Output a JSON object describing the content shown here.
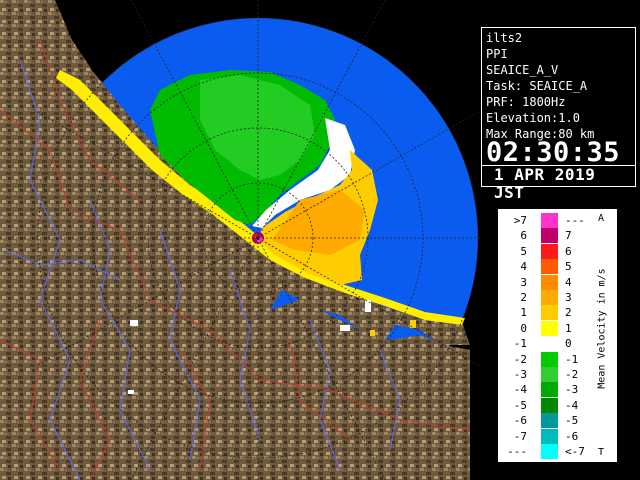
{
  "info": {
    "station": "ilts2",
    "product": "PPI",
    "data_type": "SEAICE_A_V",
    "task": "Task: SEAICE_A",
    "prf": "PRF: 1800Hz",
    "elevation": "Elevation:1.0",
    "max_range": "Max Range:80 km",
    "time": "02:30:35",
    "date": "1 APR 2019 JST"
  },
  "legend": {
    "title": "Mean Velocity in m/s",
    "corner_top": "A",
    "corner_bottom": "T",
    "rows": [
      {
        "left": ">7",
        "right": "---",
        "color": "#ff33cc"
      },
      {
        "left": "6",
        "right": "7",
        "color": "#c0006a"
      },
      {
        "left": "5",
        "right": "6",
        "color": "#ff1a1a"
      },
      {
        "left": "4",
        "right": "5",
        "color": "#ff5a00"
      },
      {
        "left": "3",
        "right": "4",
        "color": "#ff8c00"
      },
      {
        "left": "2",
        "right": "3",
        "color": "#ffaa00"
      },
      {
        "left": "1",
        "right": "2",
        "color": "#ffcc00"
      },
      {
        "left": "0",
        "right": "1",
        "color": "#ffff00"
      },
      {
        "left": "-1",
        "right": "0",
        "color": "#ffffff"
      },
      {
        "left": "-2",
        "right": "-1",
        "color": "#00cc00"
      },
      {
        "left": "-3",
        "right": "-2",
        "color": "#33cc33"
      },
      {
        "left": "-4",
        "right": "-3",
        "color": "#00aa00"
      },
      {
        "left": "-5",
        "right": "-4",
        "color": "#008800"
      },
      {
        "left": "-6",
        "right": "-5",
        "color": "#009999"
      },
      {
        "left": "-7",
        "right": "-6",
        "color": "#00bbbb"
      },
      {
        "left": "---",
        "right": "<-7",
        "color": "#00ffff"
      }
    ]
  },
  "colors": {
    "sea": "#0a5cf0",
    "background": "#000000",
    "land": "#7a6446",
    "range_ring": "#222222"
  }
}
